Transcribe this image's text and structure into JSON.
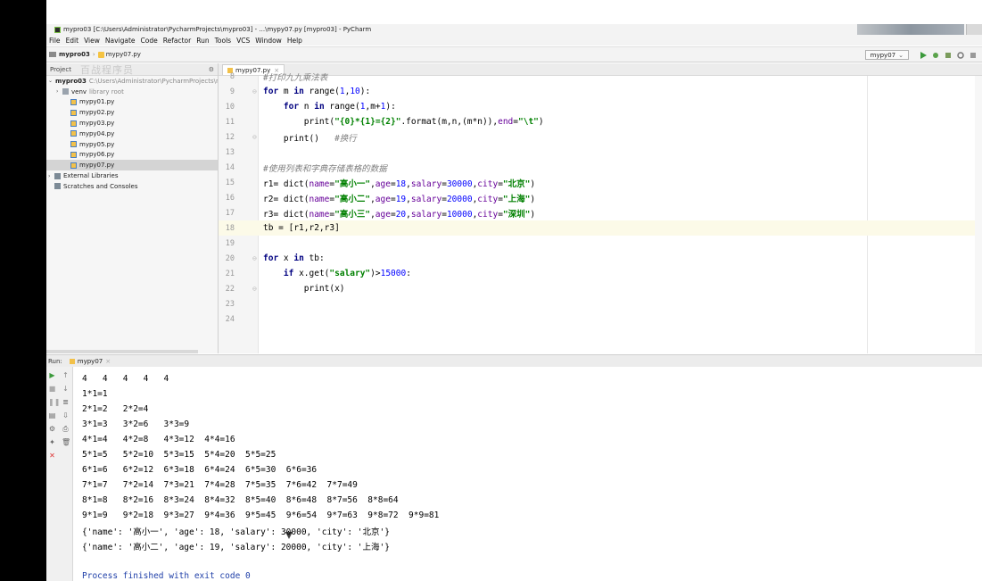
{
  "window": {
    "title": "mypro03 [C:\\Users\\Administrator\\PycharmProjects\\mypro03] - ...\\mypy07.py [mypro03] - PyCharm"
  },
  "menu": [
    "File",
    "Edit",
    "View",
    "Navigate",
    "Code",
    "Refactor",
    "Run",
    "Tools",
    "VCS",
    "Window",
    "Help"
  ],
  "breadcrumb": {
    "project": "mypro03",
    "file": "mypy07.py"
  },
  "run_config": "mypy07",
  "project_panel": {
    "header": "Project",
    "watermark": "百战程序员",
    "items": [
      {
        "label": "mypro03",
        "extra": "C:\\Users\\Administrator\\PycharmProjects\\m",
        "type": "folder",
        "level": 0,
        "expanded": true
      },
      {
        "label": "venv",
        "extra": "library root",
        "type": "folder",
        "level": 1,
        "expanded": false
      },
      {
        "label": "mypy01.py",
        "extra": "",
        "type": "py",
        "level": 2
      },
      {
        "label": "mypy02.py",
        "extra": "",
        "type": "py",
        "level": 2
      },
      {
        "label": "mypy03.py",
        "extra": "",
        "type": "py",
        "level": 2
      },
      {
        "label": "mypy04.py",
        "extra": "",
        "type": "py",
        "level": 2
      },
      {
        "label": "mypy05.py",
        "extra": "",
        "type": "py",
        "level": 2
      },
      {
        "label": "mypy06.py",
        "extra": "",
        "type": "py",
        "level": 2
      },
      {
        "label": "mypy07.py",
        "extra": "",
        "type": "py",
        "level": 2,
        "selected": true
      },
      {
        "label": "External Libraries",
        "extra": "",
        "type": "lib",
        "level": 0,
        "expanded": false
      },
      {
        "label": "Scratches and Consoles",
        "extra": "",
        "type": "scratch",
        "level": 0
      }
    ]
  },
  "editor": {
    "tab": "mypy07.py",
    "lines": [
      {
        "n": "8",
        "code": "#打印九九乘法表"
      },
      {
        "n": "9",
        "code": "for m in range(1,10):"
      },
      {
        "n": "10",
        "code": "    for n in range(1,m+1):"
      },
      {
        "n": "11",
        "code": "        print(\"{0}*{1}={2}\".format(m,n,(m*n)),end=\"\\t\")"
      },
      {
        "n": "12",
        "code": "    print()   #换行"
      },
      {
        "n": "13",
        "code": ""
      },
      {
        "n": "14",
        "code": "#使用列表和字典存储表格的数据"
      },
      {
        "n": "15",
        "code": "r1= dict(name=\"高小一\",age=18,salary=30000,city=\"北京\")"
      },
      {
        "n": "16",
        "code": "r2= dict(name=\"高小二\",age=19,salary=20000,city=\"上海\")"
      },
      {
        "n": "17",
        "code": "r3= dict(name=\"高小三\",age=20,salary=10000,city=\"深圳\")"
      },
      {
        "n": "18",
        "code": "tb = [r1,r2,r3]"
      },
      {
        "n": "19",
        "code": ""
      },
      {
        "n": "20",
        "code": "for x in tb:"
      },
      {
        "n": "21",
        "code": "    if x.get(\"salary\")>15000:"
      },
      {
        "n": "22",
        "code": "        print(x)"
      },
      {
        "n": "23",
        "code": ""
      },
      {
        "n": "24",
        "code": ""
      }
    ]
  },
  "run_panel": {
    "label": "Run:",
    "tab": "mypy07",
    "output": [
      "4   4   4   4   4",
      "1*1=1",
      "2*1=2   2*2=4",
      "3*1=3   3*2=6   3*3=9",
      "4*1=4   4*2=8   4*3=12  4*4=16",
      "5*1=5   5*2=10  5*3=15  5*4=20  5*5=25",
      "6*1=6   6*2=12  6*3=18  6*4=24  6*5=30  6*6=36",
      "7*1=7   7*2=14  7*3=21  7*4=28  7*5=35  7*6=42  7*7=49",
      "8*1=8   8*2=16  8*3=24  8*4=32  8*5=40  8*6=48  8*7=56  8*8=64",
      "9*1=9   9*2=18  9*3=27  9*4=36  9*5=45  9*6=54  9*7=63  9*8=72  9*9=81",
      "{'name': '高小一', 'age': 18, 'salary': 30000, 'city': '北京'}",
      "{'name': '高小二', 'age': 19, 'salary': 20000, 'city': '上海'}",
      "",
      "Process finished with exit code 0"
    ]
  }
}
